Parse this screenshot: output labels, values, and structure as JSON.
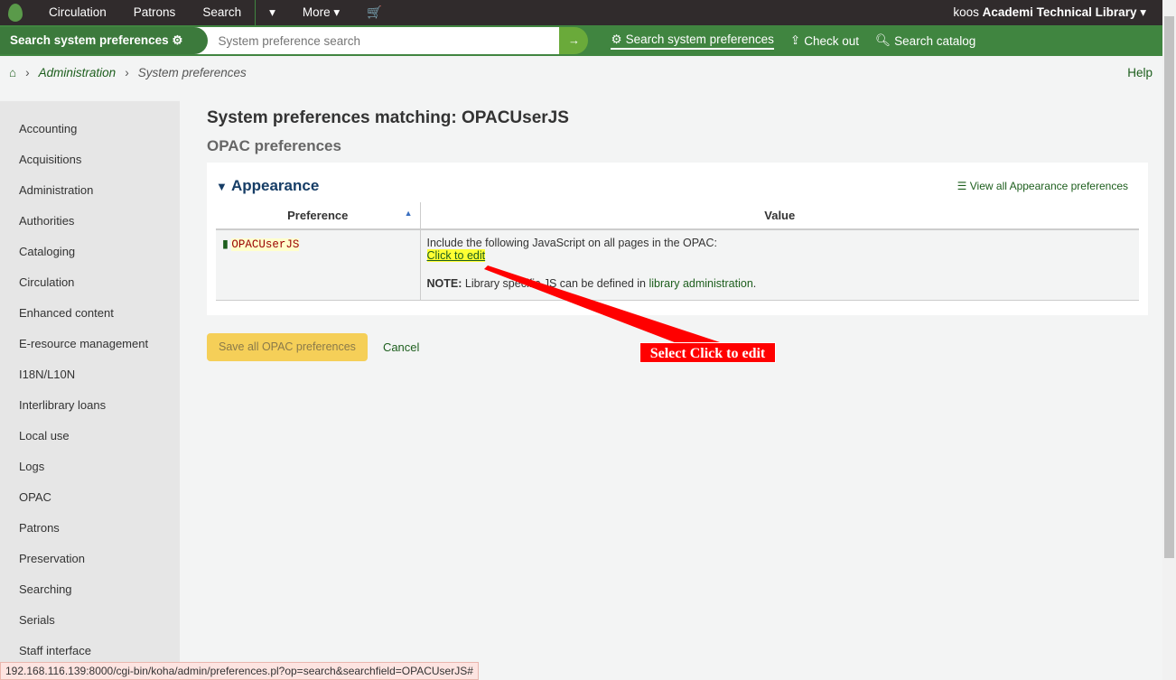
{
  "topnav": {
    "items": [
      "Circulation",
      "Patrons",
      "Search",
      "More"
    ],
    "user": "koos",
    "library": "Academi Technical Library"
  },
  "searchbar": {
    "label": "Search system preferences",
    "placeholder": "System preference search",
    "links": [
      "Search system preferences",
      "Check out",
      "Search catalog"
    ]
  },
  "breadcrumb": [
    "Administration",
    "System preferences"
  ],
  "help": "Help",
  "sidebar": [
    "Accounting",
    "Acquisitions",
    "Administration",
    "Authorities",
    "Cataloging",
    "Circulation",
    "Enhanced content",
    "E-resource management",
    "I18N/L10N",
    "Interlibrary loans",
    "Local use",
    "Logs",
    "OPAC",
    "Patrons",
    "Preservation",
    "Searching",
    "Serials",
    "Staff interface"
  ],
  "main": {
    "title": "System preferences matching: OPACUserJS",
    "subtitle": "OPAC preferences",
    "panel": {
      "title": "Appearance",
      "view_all": "View all Appearance preferences",
      "col_pref": "Preference",
      "col_value": "Value",
      "pref_name": "OPACUserJS",
      "desc": "Include the following JavaScript on all pages in the OPAC:",
      "edit": "Click to edit",
      "note_label": "NOTE:",
      "note_text": " Library specific JS can be defined in ",
      "note_link": "library administration",
      "note_end": "."
    },
    "save": "Save all OPAC preferences",
    "cancel": "Cancel"
  },
  "annotation": "Select Click to edit",
  "status_url": "192.168.116.139:8000/cgi-bin/koha/admin/preferences.pl?op=search&searchfield=OPACUserJS#"
}
